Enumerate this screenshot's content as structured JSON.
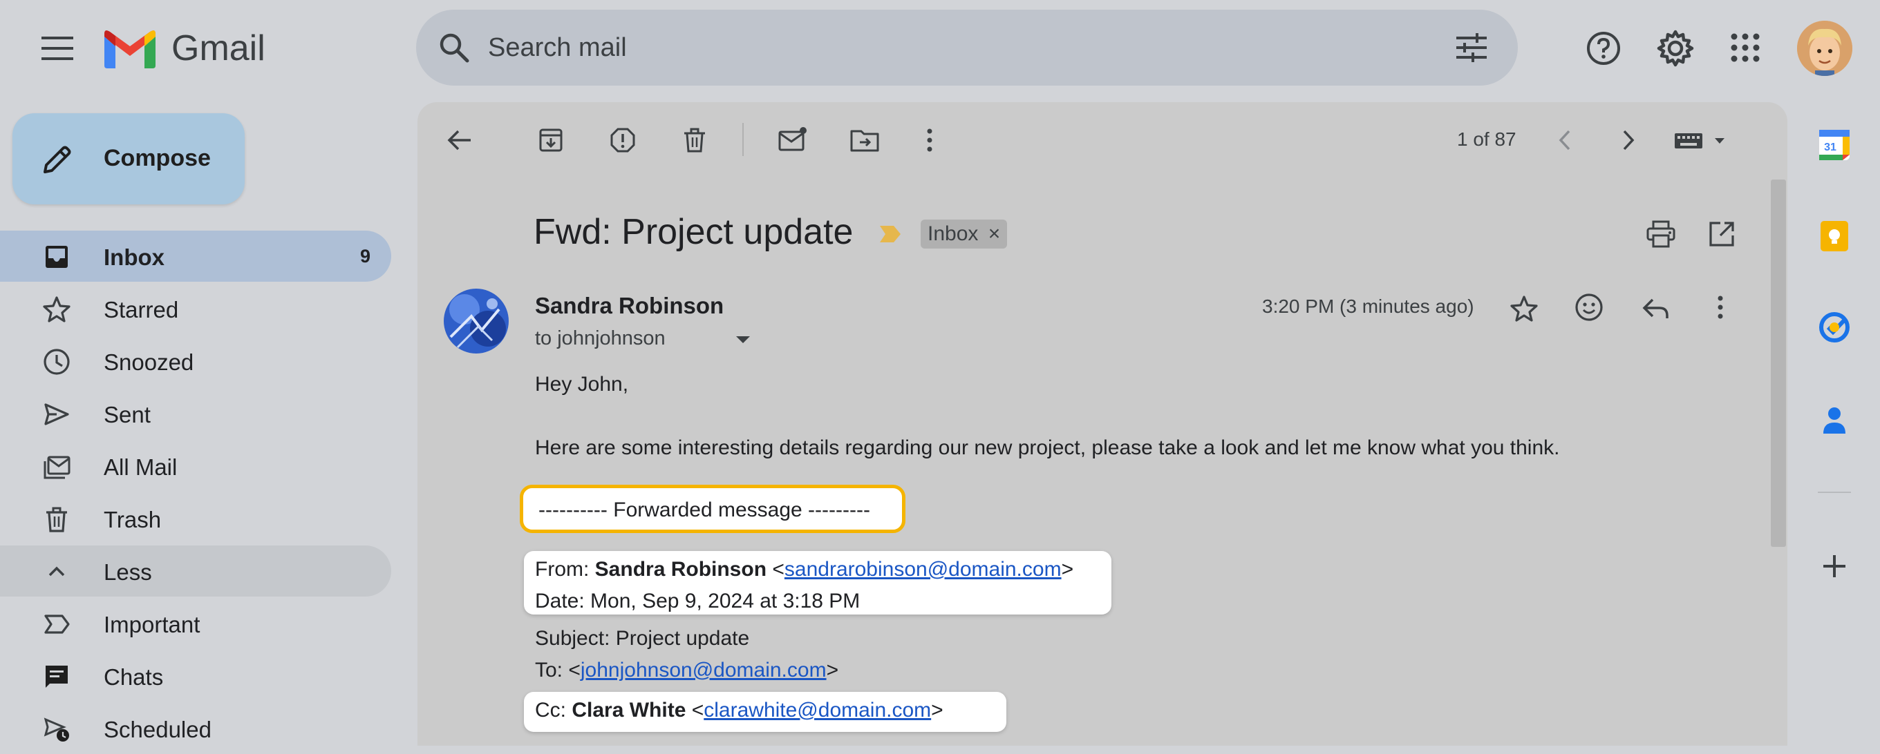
{
  "app": {
    "logo_text": "Gmail",
    "search_placeholder": "Search mail"
  },
  "compose": {
    "label": "Compose"
  },
  "sidebar": {
    "items": [
      {
        "label": "Inbox",
        "count": "9",
        "icon": "inbox-icon",
        "state": "active"
      },
      {
        "label": "Starred",
        "icon": "star-icon"
      },
      {
        "label": "Snoozed",
        "icon": "clock-icon"
      },
      {
        "label": "Sent",
        "icon": "send-icon"
      },
      {
        "label": "All Mail",
        "icon": "all-mail-icon"
      },
      {
        "label": "Trash",
        "icon": "trash-icon"
      },
      {
        "label": "Less",
        "icon": "chevron-up-icon",
        "state": "hover"
      },
      {
        "label": "Important",
        "icon": "important-icon"
      },
      {
        "label": "Chats",
        "icon": "chat-icon"
      },
      {
        "label": "Scheduled",
        "icon": "scheduled-icon"
      }
    ]
  },
  "toolbar": {
    "pager": "1 of 87"
  },
  "message": {
    "subject": "Fwd: Project update",
    "label_badge": "Inbox",
    "label_badge_close": "×",
    "sender_name": "Sandra Robinson",
    "to_line": "to johnjohnson",
    "time": "3:20 PM (3 minutes ago)",
    "greeting": "Hey John,",
    "body": "Here are some interesting details regarding our new project, please take a look and let me know what you think.",
    "forwarded_header": "---------- Forwarded message ---------",
    "from_label": "From: ",
    "from_name": "Sandra Robinson",
    "from_email": "sandrarobinson@domain.com",
    "date_line": "Date: Mon, Sep 9, 2024 at 3:18 PM",
    "subject_line": "Subject: Project update",
    "to_label": "To: ",
    "to_email": "johnjohnson@domain.com",
    "cc_label": "Cc: ",
    "cc_name": "Clara White",
    "cc_email": "clarawhite@domain.com",
    "lt": "<",
    "gt": ">"
  },
  "right_rail": {
    "calendar_day": "31"
  },
  "colors": {
    "highlight_border": "#f5b400",
    "link": "#1a56c4",
    "active_nav": "#aebfd6"
  }
}
